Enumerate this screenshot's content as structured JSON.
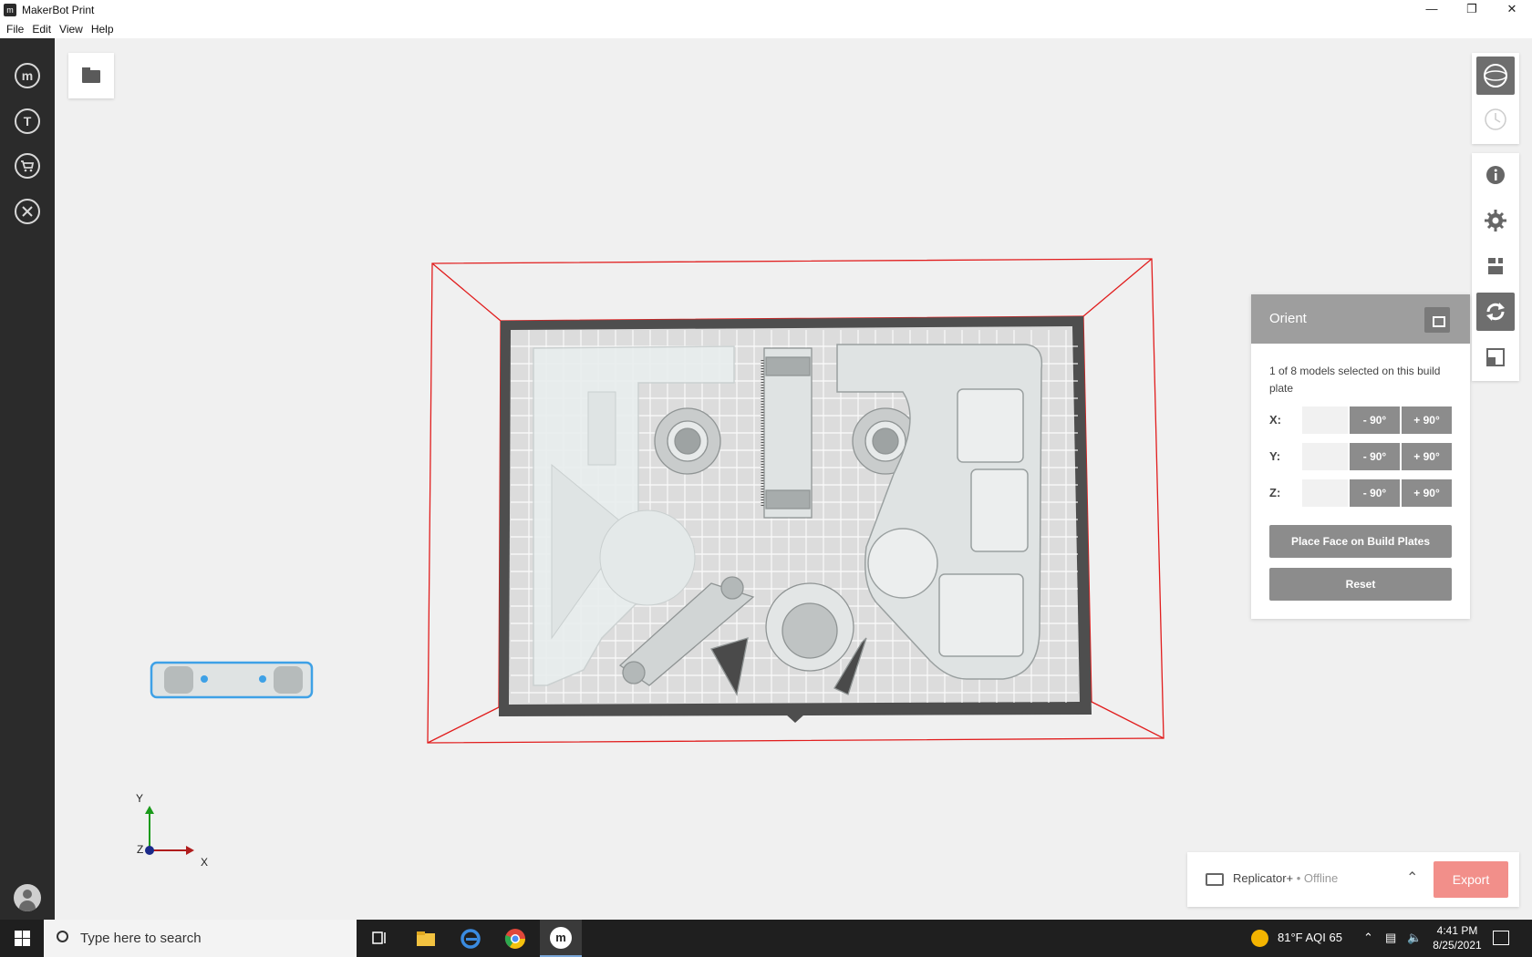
{
  "window": {
    "title": "MakerBot Print",
    "controls": [
      "minimize",
      "restore",
      "close"
    ]
  },
  "menu": [
    "File",
    "Edit",
    "View",
    "Help"
  ],
  "left_rail": {
    "items": [
      "makerbot-home",
      "thingiverse",
      "store",
      "tools"
    ]
  },
  "viewport": {
    "axes": {
      "y": "Y",
      "z": "Z",
      "x": "X"
    }
  },
  "orient_panel": {
    "title": "Orient",
    "description": "1 of 8 models selected on this build plate",
    "rows": [
      {
        "axis": "X:",
        "minus": "- 90°",
        "plus": "+ 90°"
      },
      {
        "axis": "Y:",
        "minus": "- 90°",
        "plus": "+ 90°"
      },
      {
        "axis": "Z:",
        "minus": "- 90°",
        "plus": "+ 90°"
      }
    ],
    "place_face_label": "Place Face on Build Plates",
    "reset_label": "Reset"
  },
  "printer": {
    "name": "Replicator+",
    "status": "• Offline",
    "export_label": "Export",
    "export_color": "#f28f8a"
  },
  "taskbar": {
    "search_placeholder": "Type here to search",
    "weather": "81°F  AQI 65",
    "time": "4:41 PM",
    "date": "8/25/2021"
  },
  "colors": {
    "build_volume_lines": "#e11d1d",
    "left_rail": "#2b2b2b",
    "selected_outline": "#3ea1e6"
  }
}
